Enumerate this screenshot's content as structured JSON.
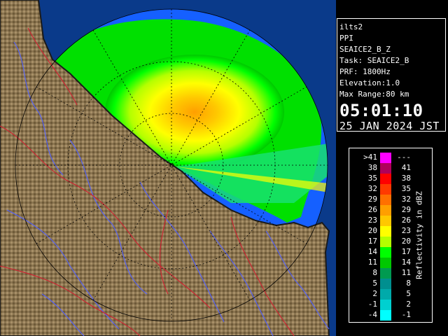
{
  "info": {
    "site": "ilts2",
    "product": "PPI",
    "product_id": "SEAICE2_B_Z",
    "task": "Task: SEAICE2_B",
    "prf": "PRF: 1800Hz",
    "elevation": "Elevation:1.0",
    "max_range": "Max Range:80 km",
    "time": "05:01:10",
    "date": "25 JAN 2024 JST"
  },
  "legend": {
    "unit": "Reflectivity in dBZ",
    "rows": [
      {
        "lo": ">41",
        "hi": "---",
        "color": "#ff00ff"
      },
      {
        "lo": "38",
        "hi": "41",
        "color": "#b0005a"
      },
      {
        "lo": "35",
        "hi": "38",
        "color": "#ff0000"
      },
      {
        "lo": "32",
        "hi": "35",
        "color": "#ff3a00"
      },
      {
        "lo": "29",
        "hi": "32",
        "color": "#ff7000"
      },
      {
        "lo": "26",
        "hi": "29",
        "color": "#ff9f00"
      },
      {
        "lo": "23",
        "hi": "26",
        "color": "#ffc800"
      },
      {
        "lo": "20",
        "hi": "23",
        "color": "#ffff00"
      },
      {
        "lo": "17",
        "hi": "20",
        "color": "#b4ff00"
      },
      {
        "lo": "14",
        "hi": "17",
        "color": "#00ff00"
      },
      {
        "lo": "11",
        "hi": "14",
        "color": "#00c800"
      },
      {
        "lo": "8",
        "hi": "11",
        "color": "#009a50"
      },
      {
        "lo": "5",
        "hi": "8",
        "color": "#008f8f"
      },
      {
        "lo": "2",
        "hi": "5",
        "color": "#00aaaa"
      },
      {
        "lo": "-1",
        "hi": "2",
        "color": "#00d0d0"
      },
      {
        "lo": "-4",
        "hi": "-1",
        "color": "#00ffff"
      }
    ]
  },
  "colors": {
    "sea": "#0a3a8a",
    "range_disc": "#1560ff",
    "land": "#8a7450",
    "coast": "#1a1a1a",
    "rivers": "#5060ff",
    "boundaries": "#d02030"
  }
}
